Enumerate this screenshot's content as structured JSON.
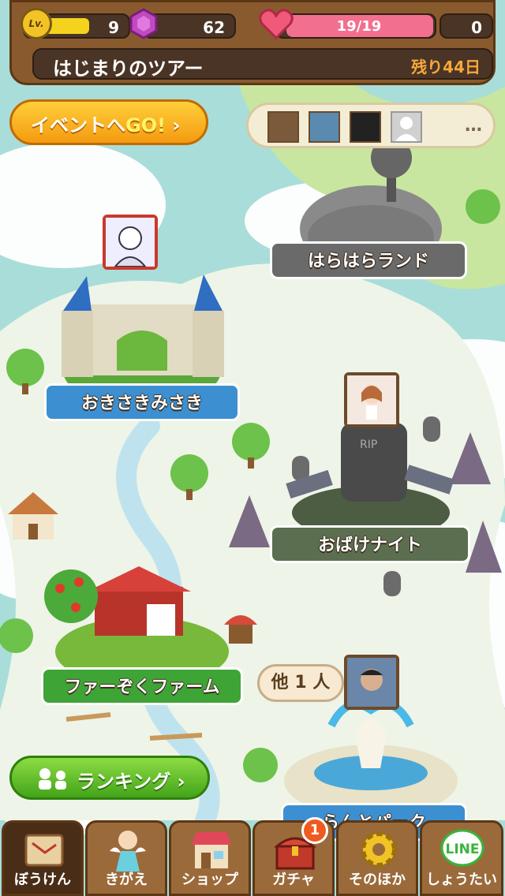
{
  "hud": {
    "level_label": "Lv.",
    "level": "9",
    "gems": "62",
    "hp_text": "19/19",
    "hp_fraction": 1.0,
    "coins": "0",
    "tour_title": "はじまりのツアー",
    "days_left": "残り44日"
  },
  "event_button": {
    "label_main": "イベントへ",
    "label_go": "GO!",
    "chevron": "›"
  },
  "friends": {
    "more": "…",
    "avatars": [
      "friend-1",
      "friend-2",
      "friend-3",
      "friend-placeholder"
    ]
  },
  "locations": [
    {
      "name": "はらはらランド"
    },
    {
      "name": "おきさきみさき"
    },
    {
      "name": "おばけナイト"
    },
    {
      "name": "ファーぞくファーム"
    },
    {
      "name": "らんとパーク"
    }
  ],
  "other_count": "他 1 人",
  "ranking": {
    "label": "ランキング",
    "chevron": "›"
  },
  "nav": {
    "tabs": [
      {
        "label": "ぼうけん"
      },
      {
        "label": "きがえ"
      },
      {
        "label": "ショップ"
      },
      {
        "label": "ガチャ"
      },
      {
        "label": "そのほか"
      },
      {
        "label": "しょうたい"
      }
    ],
    "gacha_badge": "1",
    "line_logo": "LINE"
  },
  "colors": {
    "accent_orange": "#f49a10",
    "ranking_green": "#43a419",
    "hp_pink": "#f26f8f"
  }
}
